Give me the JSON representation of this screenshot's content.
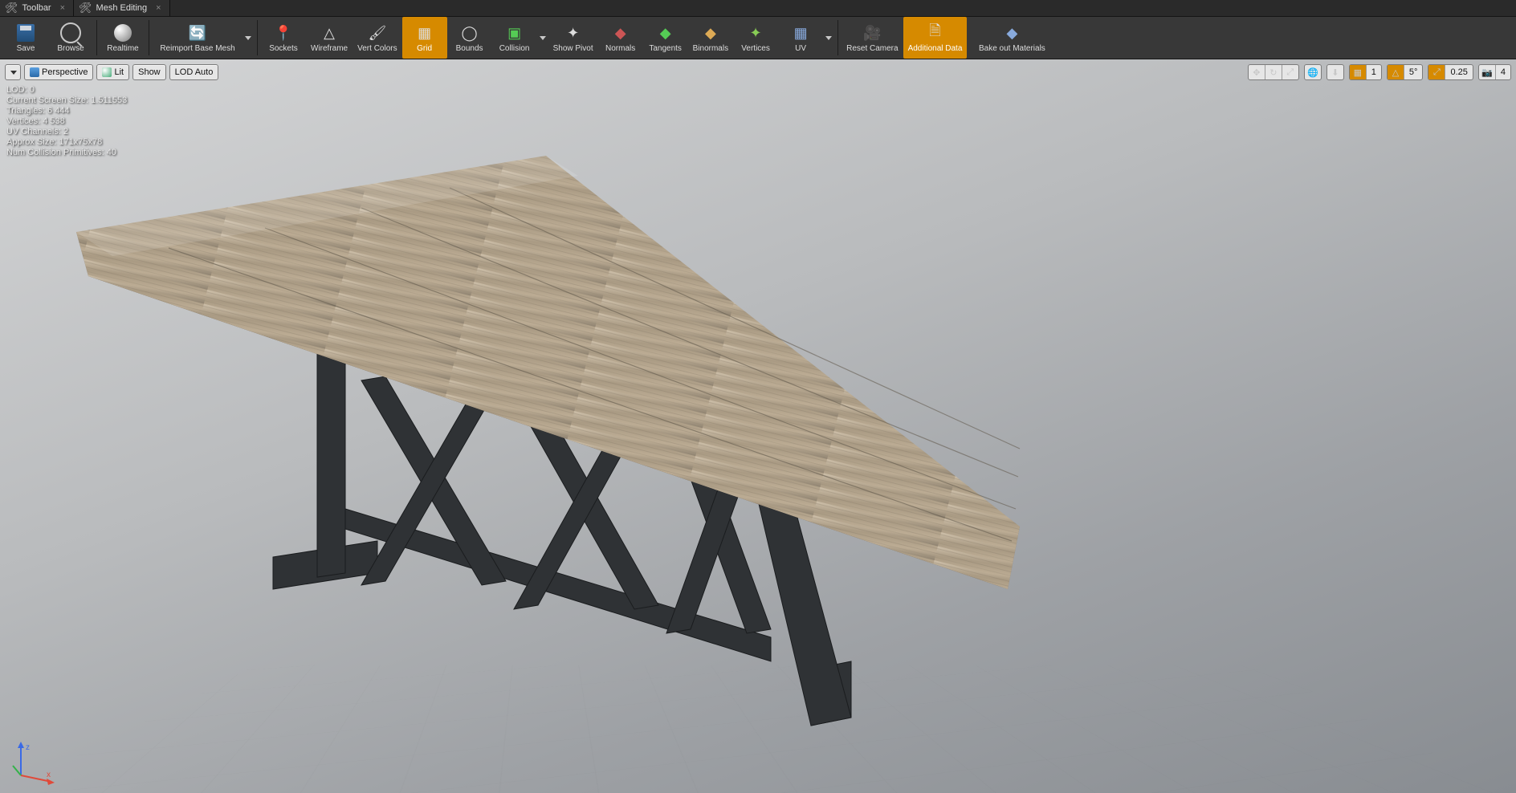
{
  "tabs": {
    "toolbar": "Toolbar",
    "mesh_editing": "Mesh Editing"
  },
  "toolbar": {
    "save": "Save",
    "browse": "Browse",
    "realtime": "Realtime",
    "reimport": "Reimport Base Mesh",
    "sockets": "Sockets",
    "wireframe": "Wireframe",
    "vert_colors": "Vert Colors",
    "grid": "Grid",
    "bounds": "Bounds",
    "collision": "Collision",
    "show_pivot": "Show Pivot",
    "normals": "Normals",
    "tangents": "Tangents",
    "binormals": "Binormals",
    "vertices": "Vertices",
    "uv": "UV",
    "reset_camera": "Reset Camera",
    "additional_data": "Additional Data",
    "bake_materials": "Bake out Materials"
  },
  "view_controls": {
    "perspective": "Perspective",
    "lit": "Lit",
    "show": "Show",
    "lod_auto": "LOD Auto"
  },
  "right_controls": {
    "grid_value": "1",
    "angle_value": "5°",
    "snap_value": "0.25",
    "camera_speed": "4"
  },
  "stats": {
    "lod": "LOD:  0",
    "screen_size": "Current Screen Size:  1.511553",
    "triangles": "Triangles:  6 444",
    "vertices": "Vertices:  4 538",
    "uv_channels": "UV Channels:  2",
    "approx_size": "Approx Size:  171x75x78",
    "collision_prims": "Num Collision Primitives:  40"
  },
  "gizmo": {
    "x": "x",
    "z": "z"
  }
}
